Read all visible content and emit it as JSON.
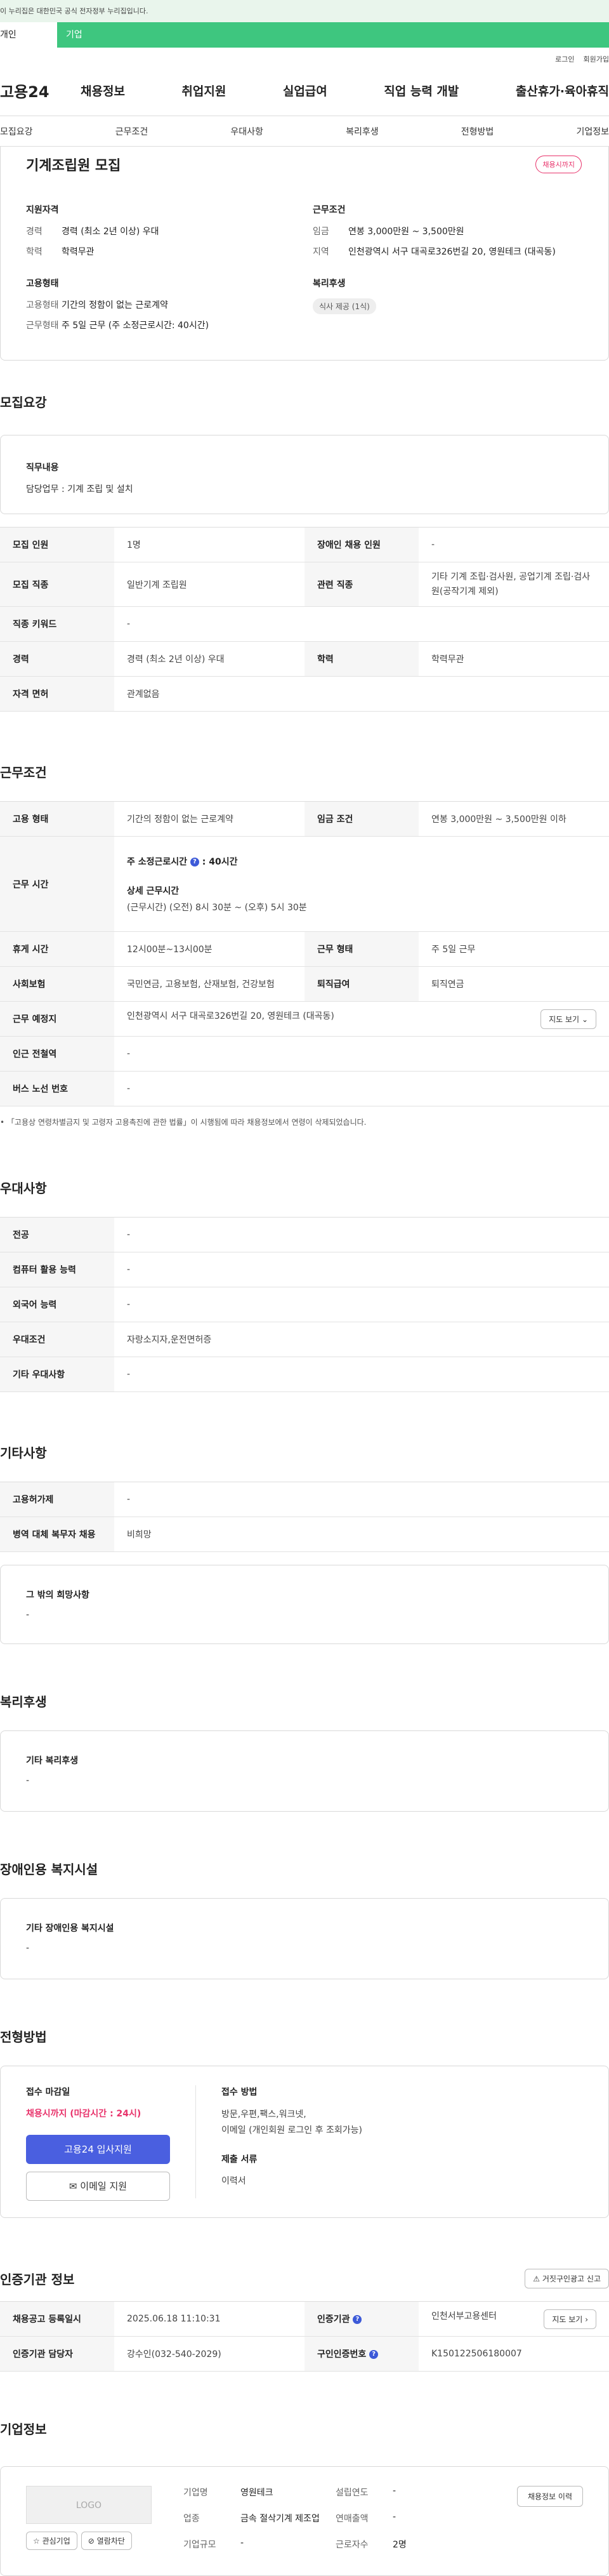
{
  "gov_banner": "이 누리집은 대한민국 공식 전자정부 누리집입니다.",
  "user_tabs": {
    "personal": "개인",
    "company": "기업"
  },
  "util": {
    "login": "로그인",
    "join": "회원가입"
  },
  "gnb": {
    "logo": "고용24",
    "menu": [
      "채용정보",
      "취업지원",
      "실업급여",
      "직업 능력 개발",
      "출산휴가·육아휴직"
    ]
  },
  "subnav": [
    "모집요강",
    "근무조건",
    "우대사항",
    "복리후생",
    "전형방법",
    "기업정보"
  ],
  "summary": {
    "title": "기계조립원 모집",
    "badge": "채용시까지",
    "qual_title": "지원자격",
    "career_k": "경력",
    "career_v": "경력 (최소 2년 이상) 우대",
    "edu_k": "학력",
    "edu_v": "학력무관",
    "emp_title": "고용형태",
    "emptype_k": "고용형태",
    "emptype_v": "기간의 정함이 없는 근로계약",
    "worktype_k": "근무형태",
    "worktype_v": "주 5일 근무 (주 소정근로시간: 40시간)",
    "cond_title": "근무조건",
    "wage_k": "임금",
    "wage_v": "연봉 3,000만원 ~ 3,500만원",
    "area_k": "지역",
    "area_v": "인천광역시 서구 대곡로326번길 20, 영원테크 (대곡동)",
    "welfare_title": "복리후생",
    "welfare_chip": "식사 제공 (1식)"
  },
  "recruit": {
    "title": "모집요강",
    "duty_title": "직무내용",
    "duty_text": "담당업무 : 기계 조립 및 설치",
    "rows": [
      {
        "k1": "모집 인원",
        "v1": "1명",
        "k2": "장애인 채용 인원",
        "v2": "-"
      },
      {
        "k1": "모집 직종",
        "v1": "일반기계 조립원",
        "k2": "관련 직종",
        "v2": "기타 기계 조립·검사원, 공업기계 조립·검사원(공작기계 제외)"
      },
      {
        "k1": "직종 키워드",
        "v1": "-"
      },
      {
        "k1": "경력",
        "v1": "경력 (최소 2년 이상) 우대",
        "k2": "학력",
        "v2": "학력무관"
      },
      {
        "k1": "자격 면허",
        "v1": "관계없음"
      }
    ]
  },
  "work": {
    "title": "근무조건",
    "emptype_k": "고용 형태",
    "emptype_v": "기간의 정함이 없는 근로계약",
    "wage_k": "임금 조건",
    "wage_v": "연봉 3,000만원 ~ 3,500만원 이하",
    "hours_k": "근무 시간",
    "hours_week_label": "주 소정근로시간",
    "hours_week_value": ": 40시간",
    "hours_detail_label": "상세 근무시간",
    "hours_detail_value": "(근무시간) (오전) 8시 30분 ~ (오후) 5시 30분",
    "rest_k": "휴게 시간",
    "rest_v": "12시00분~13시00분",
    "form_k": "근무 형태",
    "form_v": "주 5일 근무",
    "ins_k": "사회보험",
    "ins_v": "국민연금, 고용보험, 산재보험, 건강보험",
    "sev_k": "퇴직급여",
    "sev_v": "퇴직연금",
    "place_k": "근무 예정지",
    "place_v": "인천광역시 서구 대곡로326번길 20, 영원테크 (대곡동)",
    "map_btn": "지도 보기",
    "subway_k": "인근 전철역",
    "subway_v": "-",
    "bus_k": "버스 노선 번호",
    "bus_v": "-",
    "note": "「고용상 연령차별금지 및 고령자 고용촉진에 관한 법률」이 시행됨에 따라 채용정보에서 연령이 삭제되었습니다."
  },
  "pref": {
    "title": "우대사항",
    "rows": [
      {
        "k": "전공",
        "v": "-"
      },
      {
        "k": "컴퓨터 활용 능력",
        "v": "-"
      },
      {
        "k": "외국어 능력",
        "v": "-"
      },
      {
        "k": "우대조건",
        "v": "자랑소지자,운전면허증"
      },
      {
        "k": "기타 우대사항",
        "v": "-"
      }
    ]
  },
  "etc": {
    "title": "기타사항",
    "rows": [
      {
        "k": "고용허가제",
        "v": "-"
      },
      {
        "k": "병역 대체 복무자 채용",
        "v": "비희망"
      }
    ],
    "box_title": "그 밖의 희망사항",
    "box_text": "-"
  },
  "welfare": {
    "title": "복리후생",
    "box_title": "기타 복리후생",
    "box_text": "-"
  },
  "disabled": {
    "title": "장애인용 복지시설",
    "box_title": "기타 장애인용 복지시설",
    "box_text": "-"
  },
  "apply": {
    "title": "전형방법",
    "deadline_label": "접수 마감일",
    "deadline_value": "채용시까지 (마감시간 : 24시)",
    "apply_btn": "고용24 입사지원",
    "email_btn": "이메일 지원",
    "method_label": "접수 방법",
    "method_value1": "방문,우편,팩스,워크넷,",
    "method_value2": "이메일 (개인회원 로그인 후 조회가능)",
    "docs_label": "제출 서류",
    "docs_value": "이력서"
  },
  "cert": {
    "title": "인증기관 정보",
    "report_btn": "거짓구인광고 신고",
    "reg_k": "채용공고 등록일시",
    "reg_v": "2025.06.18 11:10:31",
    "agency_k": "인증기관",
    "agency_v": "인천서부고용센터",
    "map_btn": "지도 보기",
    "manager_k": "인증기관 담당자",
    "manager_v": "강수인(032-540-2029)",
    "num_k": "구인인증번호",
    "num_v": "K150122506180007"
  },
  "company": {
    "title": "기업정보",
    "logo": "LOGO",
    "fav_btn": "관심기업",
    "block_btn": "열람차단",
    "name_k": "기업명",
    "name_v": "영원테크",
    "year_k": "설립연도",
    "year_v": "-",
    "ind_k": "업종",
    "ind_v": "금속 절삭기계 제조업",
    "sales_k": "연매출액",
    "sales_v": "-",
    "emp_k": "근로자수",
    "emp_v": "2명",
    "size_k": "기업규모",
    "size_v": "-",
    "history_btn": "채용정보 이력"
  },
  "colors": {
    "green": "#3ec67f",
    "primary": "#4a5fe0",
    "red": "#e8336b"
  }
}
